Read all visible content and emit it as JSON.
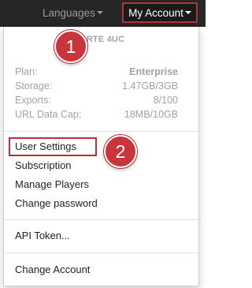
{
  "topbar": {
    "languages_label": "Languages",
    "account_label": "My Account"
  },
  "menu": {
    "organization": "ORTE 4UC",
    "stats": [
      {
        "label": "Plan:",
        "value": "Enterprise"
      },
      {
        "label": "Storage:",
        "value": "1.47GB/3GB"
      },
      {
        "label": "Exports:",
        "value": "8/100"
      },
      {
        "label": "URL Data Cap:",
        "value": "18MB/10GB"
      }
    ],
    "items": [
      {
        "label": "User Settings"
      },
      {
        "label": "Subscription"
      },
      {
        "label": "Manage Players"
      },
      {
        "label": "Change password"
      }
    ],
    "api_token": "API Token...",
    "change_account": "Change Account"
  },
  "annotations": {
    "step1": "1",
    "step2": "2",
    "accent_color": "#c8353c"
  }
}
